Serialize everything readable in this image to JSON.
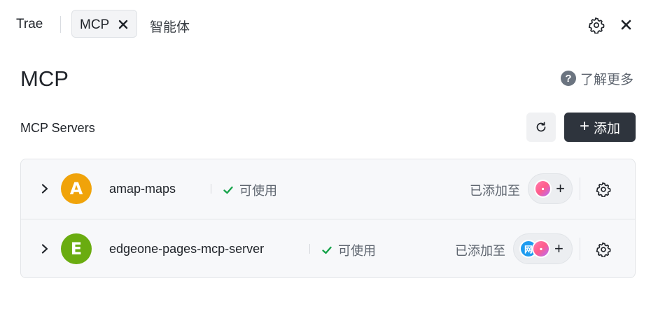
{
  "tabs": {
    "trae": "Trae",
    "mcp": "MCP",
    "agent": "智能体"
  },
  "header": {
    "title": "MCP",
    "learn_more": "了解更多"
  },
  "section": {
    "title": "MCP Servers",
    "add_label": "添加"
  },
  "servers": [
    {
      "name": "amap-maps",
      "avatar_letter": "A",
      "avatar_color": "#f0a30a",
      "status": "可使用",
      "added_label": "已添加至",
      "agents": [
        "builder-icon"
      ]
    },
    {
      "name": "edgeone-pages-mcp-server",
      "avatar_letter": "E",
      "avatar_color": "#6aac10",
      "status": "可使用",
      "added_label": "已添加至",
      "agents": [
        "web-icon",
        "builder-icon"
      ],
      "agent_text": "网"
    }
  ],
  "colors": {
    "accent": "#2e343d",
    "status_ok": "#16a34a"
  }
}
